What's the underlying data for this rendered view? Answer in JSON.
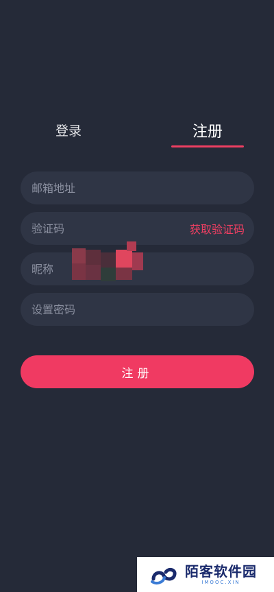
{
  "tabs": {
    "login": "登录",
    "register": "注册",
    "active": "register"
  },
  "form": {
    "email_placeholder": "邮箱地址",
    "code_placeholder": "验证码",
    "get_code_label": "获取验证码",
    "nickname_placeholder": "昵称",
    "password_placeholder": "设置密码",
    "submit_label": "注册"
  },
  "watermark": {
    "title": "陌客软件园",
    "subtitle": "IMOOC.XIN"
  },
  "colors": {
    "background": "#252a38",
    "field": "#2f3545",
    "accent": "#ef3f62",
    "placeholder": "#8b90a0"
  },
  "icons": {
    "watermark_logo": "cloud-infinity-logo"
  }
}
